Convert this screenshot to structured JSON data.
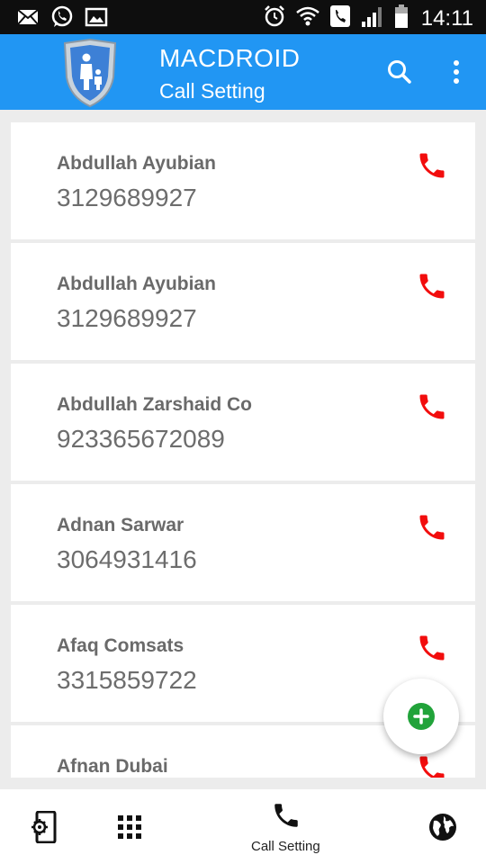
{
  "status_bar": {
    "time": "14:11",
    "icons": [
      "mail-icon",
      "whatsapp-icon",
      "gallery-icon",
      "alarm-icon",
      "wifi-icon",
      "call-status-icon",
      "signal-icon",
      "battery-icon"
    ]
  },
  "app_bar": {
    "title": "MACDROID",
    "subtitle": "Call Setting",
    "icons": [
      "shield-family-logo",
      "search-icon",
      "more-vert-icon"
    ]
  },
  "contacts": [
    {
      "name": "Abdullah Ayubian",
      "phone": "3129689927"
    },
    {
      "name": "Abdullah Ayubian",
      "phone": "3129689927"
    },
    {
      "name": "Abdullah Zarshaid Co",
      "phone": "923365672089"
    },
    {
      "name": "Adnan Sarwar",
      "phone": "3064931416"
    },
    {
      "name": "Afaq Comsats",
      "phone": "3315859722"
    },
    {
      "name": "Afnan Dubai",
      "phone": ""
    }
  ],
  "fab": {
    "icon": "add-circle-icon"
  },
  "bottom_nav": {
    "items": [
      {
        "icon": "phone-settings-icon"
      },
      {
        "icon": "apps-grid-icon"
      },
      {
        "icon": "phone-icon",
        "label": "Call Setting"
      },
      {
        "icon": "globe-icon"
      }
    ]
  },
  "colors": {
    "app_bar": "#2196f3",
    "call_icon": "#f20d0d",
    "fab_icon": "#21a33a",
    "status_bar": "#0e0e0e"
  }
}
